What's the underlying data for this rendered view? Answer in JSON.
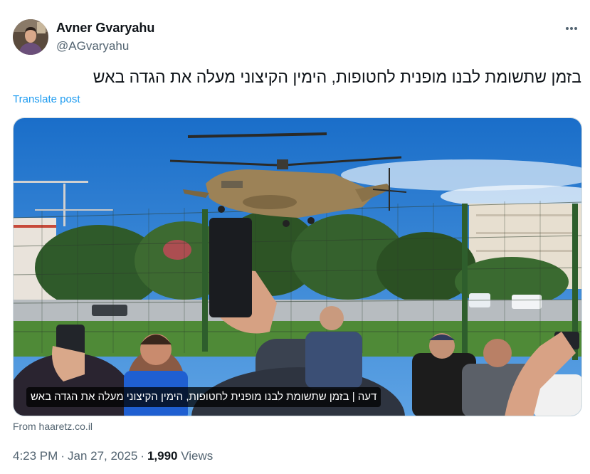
{
  "author": {
    "name": "Avner Gvaryahu",
    "handle": "@AGvaryahu",
    "avatar_icon": "person-avatar"
  },
  "tweet": {
    "text": "בזמן שתשומת לבנו מופנית לחטופות, הימין הקיצוני מעלה את הגדה באש",
    "translate_label": "Translate post"
  },
  "card": {
    "caption": "דעה | בזמן שתשומת לבנו מופנית לחטופות, הימין הקיצוני מעלה את הגדה באש",
    "source": "From haaretz.co.il",
    "image_icon": "helicopter-landing-photo"
  },
  "meta": {
    "time": "4:23 PM",
    "separator": "·",
    "date": "Jan 27, 2025",
    "views_count": "1,990",
    "views_label": "Views"
  },
  "colors": {
    "link": "#1d9bf0",
    "secondary_text": "#536471",
    "primary_text": "#0f1419",
    "border": "#cfd9de"
  }
}
